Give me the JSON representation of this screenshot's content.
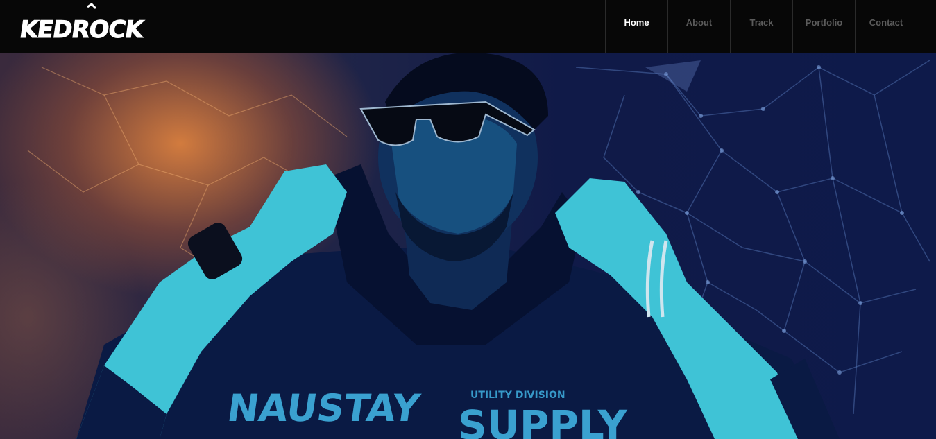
{
  "brand": {
    "logo_text": "KEDROCK"
  },
  "nav": {
    "items": [
      {
        "label": "Home",
        "active": true
      },
      {
        "label": "About",
        "active": false
      },
      {
        "label": "Track",
        "active": false
      },
      {
        "label": "Portfolio",
        "active": false
      },
      {
        "label": "Contact",
        "active": false
      }
    ]
  },
  "hero": {
    "shirt_text_left": "NAUSTAY",
    "shirt_text_small": "UTILITY DIVISION",
    "shirt_text_right": "SUPPLY"
  },
  "colors": {
    "header_bg": "#070707",
    "nav_active": "#ffffff",
    "nav_inactive": "#5b5b5b",
    "hero_dark": "#0e1a4a",
    "hero_accent": "#db803e",
    "skin_tint": "#3fc3d6"
  }
}
